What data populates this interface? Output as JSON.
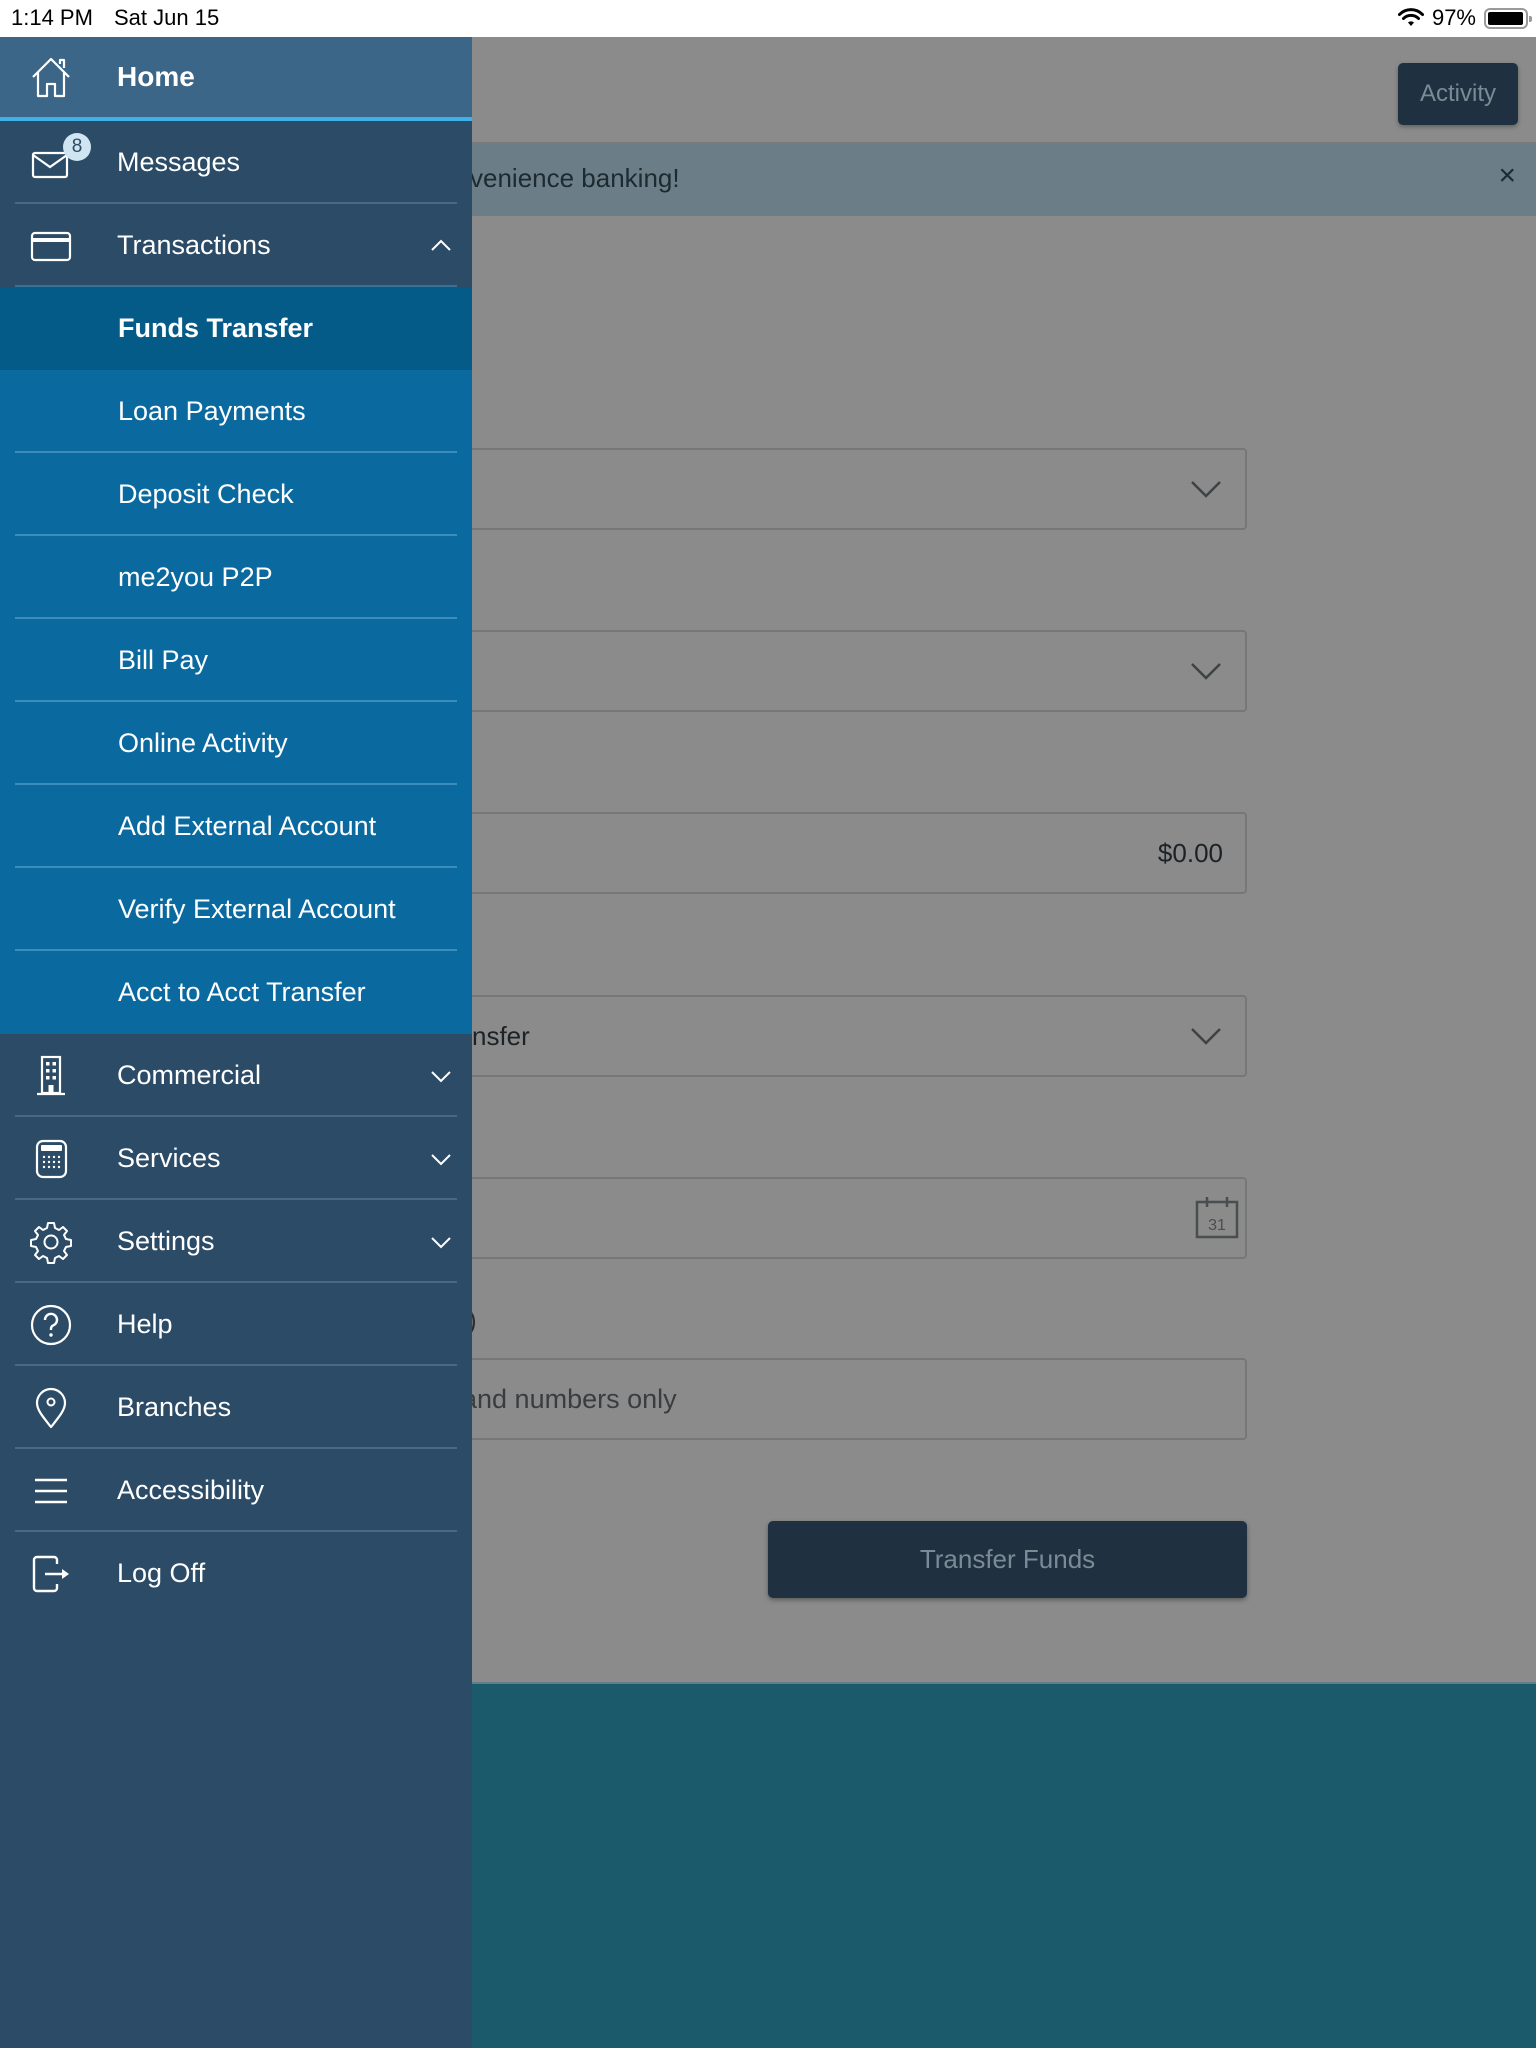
{
  "status_bar": {
    "time": "1:14 PM",
    "date": "Sat Jun 15",
    "battery_percent": "97%",
    "battery_level": 0.97,
    "wifi_icon": "wifi-icon"
  },
  "sidebar": {
    "home": {
      "label": "Home",
      "icon": "home-icon"
    },
    "messages": {
      "label": "Messages",
      "icon": "envelope-icon",
      "badge": "8"
    },
    "transactions": {
      "label": "Transactions",
      "icon": "credit-card-icon",
      "expanded": true,
      "items": [
        {
          "label": "Funds Transfer",
          "active": true
        },
        {
          "label": "Loan Payments"
        },
        {
          "label": "Deposit Check"
        },
        {
          "label": "me2you P2P"
        },
        {
          "label": "Bill Pay"
        },
        {
          "label": "Online Activity"
        },
        {
          "label": "Add External Account"
        },
        {
          "label": "Verify External Account"
        },
        {
          "label": "Acct to Acct Transfer"
        }
      ]
    },
    "commercial": {
      "label": "Commercial",
      "icon": "building-icon"
    },
    "services": {
      "label": "Services",
      "icon": "calculator-icon"
    },
    "settings": {
      "label": "Settings",
      "icon": "gear-icon"
    },
    "help": {
      "label": "Help",
      "icon": "question-circle-icon"
    },
    "branches": {
      "label": "Branches",
      "icon": "map-pin-icon"
    },
    "accessibility": {
      "label": "Accessibility",
      "icon": "menu-lines-icon"
    },
    "logoff": {
      "label": "Log Off",
      "icon": "logout-icon"
    }
  },
  "main": {
    "activity_button": "Activity",
    "banner": {
      "text": "venience banking!",
      "close": "×"
    },
    "fields": {
      "from_account": {
        "value": ""
      },
      "to_account": {
        "value": ""
      },
      "amount": {
        "value": "$0.00"
      },
      "frequency": {
        "value": "nsfer"
      },
      "date": {
        "value": "",
        "calendar_day": "31"
      },
      "memo": {
        "placeholder": "and numbers only"
      }
    },
    "partial_label": ")",
    "transfer_button": "Transfer Funds"
  },
  "colors": {
    "sidebar_bg": "#2c4b66",
    "home_bg": "#3b6688",
    "home_underline": "#3fb0e8",
    "submenu_bg": "#0a6aa0",
    "submenu_active_bg": "#045b88",
    "overlay_gray": "#8a8b8a",
    "button_dark": "#1f3141",
    "footer_teal": "#1a5a6b"
  }
}
